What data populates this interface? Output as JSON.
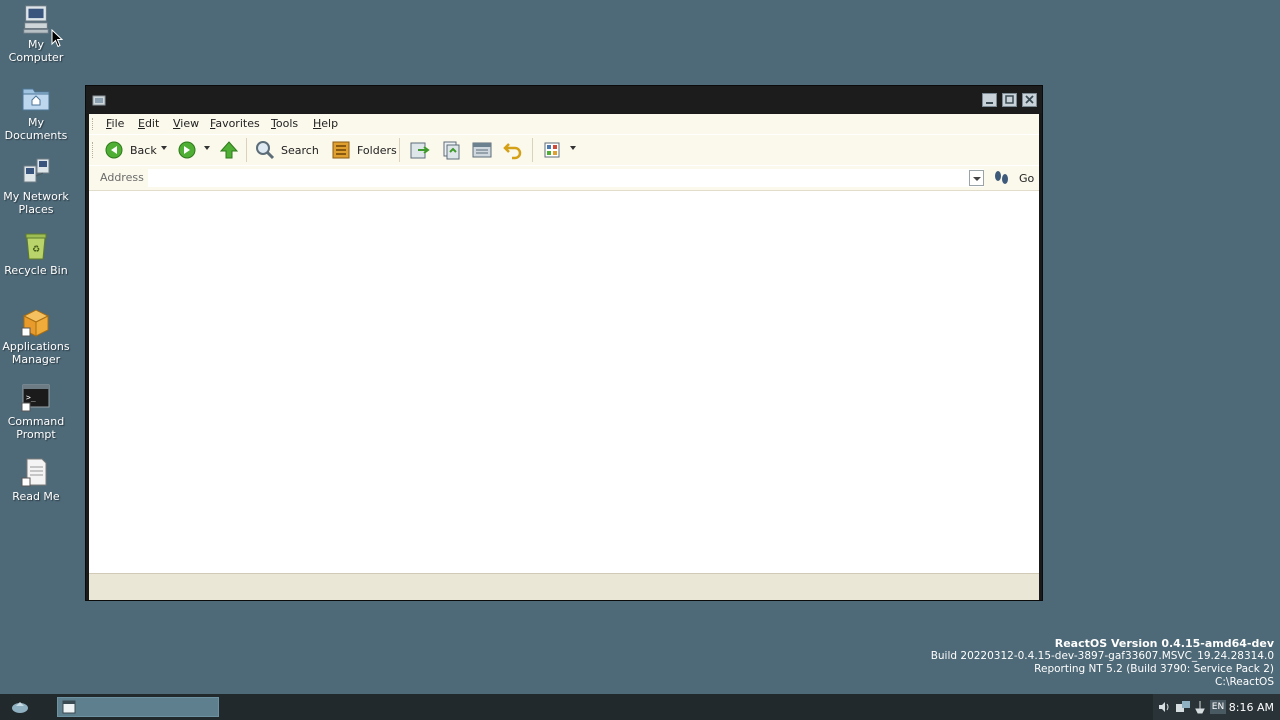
{
  "desktop_icons": [
    {
      "label_line1": "My",
      "label_line2": "Computer",
      "icon": "computer-icon"
    },
    {
      "label_line1": "My",
      "label_line2": "Documents",
      "icon": "documents-icon"
    },
    {
      "label_line1": "My Network",
      "label_line2": "Places",
      "icon": "network-icon"
    },
    {
      "label_line1": "Recycle Bin",
      "label_line2": "",
      "icon": "recycle-bin-icon"
    },
    {
      "label_line1": "Applications",
      "label_line2": "Manager",
      "icon": "applications-manager-icon"
    },
    {
      "label_line1": "Command",
      "label_line2": "Prompt",
      "icon": "command-prompt-icon"
    },
    {
      "label_line1": "Read Me",
      "label_line2": "",
      "icon": "read-me-icon"
    }
  ],
  "window": {
    "title": "",
    "menu": [
      {
        "label": "File",
        "accel": "F",
        "rest": "ile"
      },
      {
        "label": "Edit",
        "accel": "E",
        "rest": "dit"
      },
      {
        "label": "View",
        "accel": "V",
        "rest": "iew"
      },
      {
        "label": "Favorites",
        "accel": "F",
        "rest": "avorites"
      },
      {
        "label": "Tools",
        "accel": "T",
        "rest": "ools"
      },
      {
        "label": "Help",
        "accel": "H",
        "rest": "elp"
      }
    ],
    "toolbar": {
      "back_label": "Back",
      "search_label": "Search",
      "folders_label": "Folders"
    },
    "address": {
      "label": "Address",
      "value": "",
      "go_label": "Go"
    },
    "colors": {
      "accent_green": "#3e9a2a",
      "folder_orange": "#e0a030"
    }
  },
  "version_info": {
    "title": "ReactOS Version 0.4.15-amd64-dev",
    "build": "Build 20220312-0.4.15-dev-3897-gaf33607.MSVC_19.24.28314.0",
    "reporting": "Reporting NT 5.2 (Build 3790: Service Pack 2)",
    "path": "C:\\ReactOS"
  },
  "taskbar": {
    "clock": "8:16 AM",
    "language": "EN"
  }
}
